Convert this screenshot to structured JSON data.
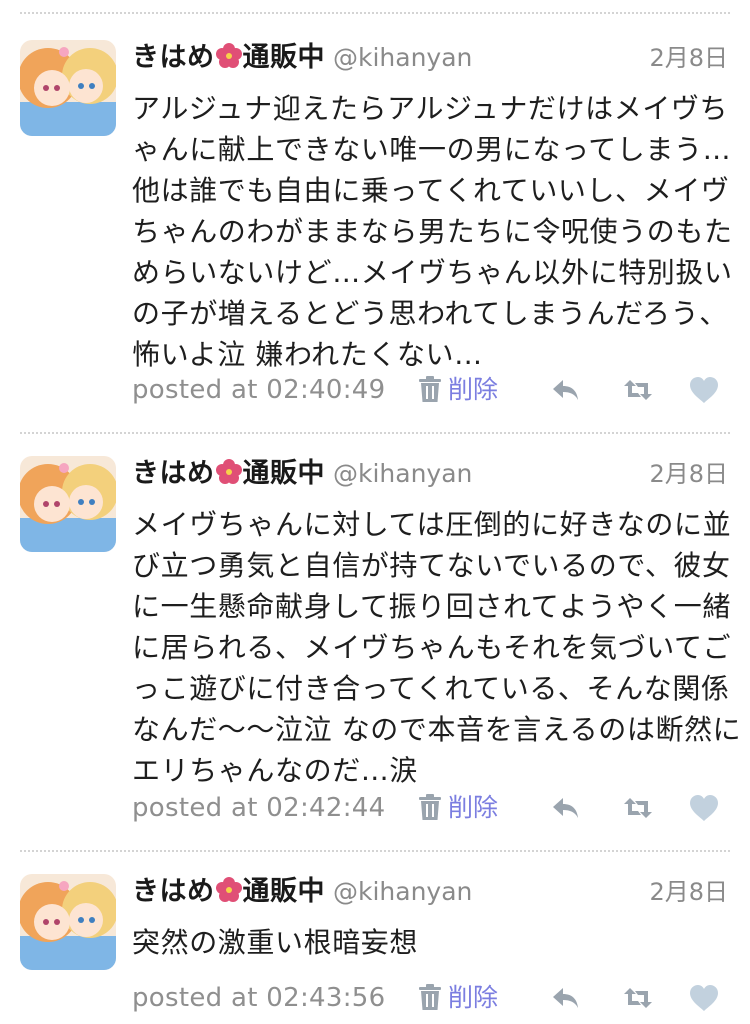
{
  "tweets": [
    {
      "name_prefix": "きはめ",
      "name_suffix": "通販中",
      "handle": "@kihanyan",
      "date": "2月8日",
      "text": "アルジュナ迎えたらアルジュナだけはメイヴちゃんに献上できない唯一の男になってしまう…他は誰でも自由に乗ってくれていいし、メイヴちゃんのわがままなら男たちに令呪使うのもためらいないけど…メイヴちゃん以外に特別扱いの子が増えるとどう思われてしまうんだろう、怖いよ泣 嫌われたくない…",
      "posted": "posted at 02:40:49",
      "delete_label": "削除"
    },
    {
      "name_prefix": "きはめ",
      "name_suffix": "通販中",
      "handle": "@kihanyan",
      "date": "2月8日",
      "text": "メイヴちゃんに対しては圧倒的に好きなのに並び立つ勇気と自信が持てないでいるので、彼女に一生懸命献身して振り回されてようやく一緒に居られる、メイヴちゃんもそれを気づいてごっこ遊びに付き合ってくれている、そんな関係なんだ〜〜泣泣 なので本音を言えるのは断然にエリちゃんなのだ…涙",
      "posted": "posted at 02:42:44",
      "delete_label": "削除"
    },
    {
      "name_prefix": "きはめ",
      "name_suffix": "通販中",
      "handle": "@kihanyan",
      "date": "2月8日",
      "text": "突然の激重い根暗妄想",
      "posted": "posted at 02:43:56",
      "delete_label": "削除"
    }
  ],
  "icons": {
    "name_emoji": "hibiscus-icon",
    "delete": "trash-icon",
    "reply": "reply-icon",
    "retweet": "retweet-icon",
    "favorite": "heart-icon"
  },
  "colors": {
    "delete_accent": "#7b7ee0",
    "meta_gray": "#8f8f8f",
    "icon_gray": "#9aa4ae",
    "heart": "#c2d1de",
    "flower": "#e04f76"
  }
}
